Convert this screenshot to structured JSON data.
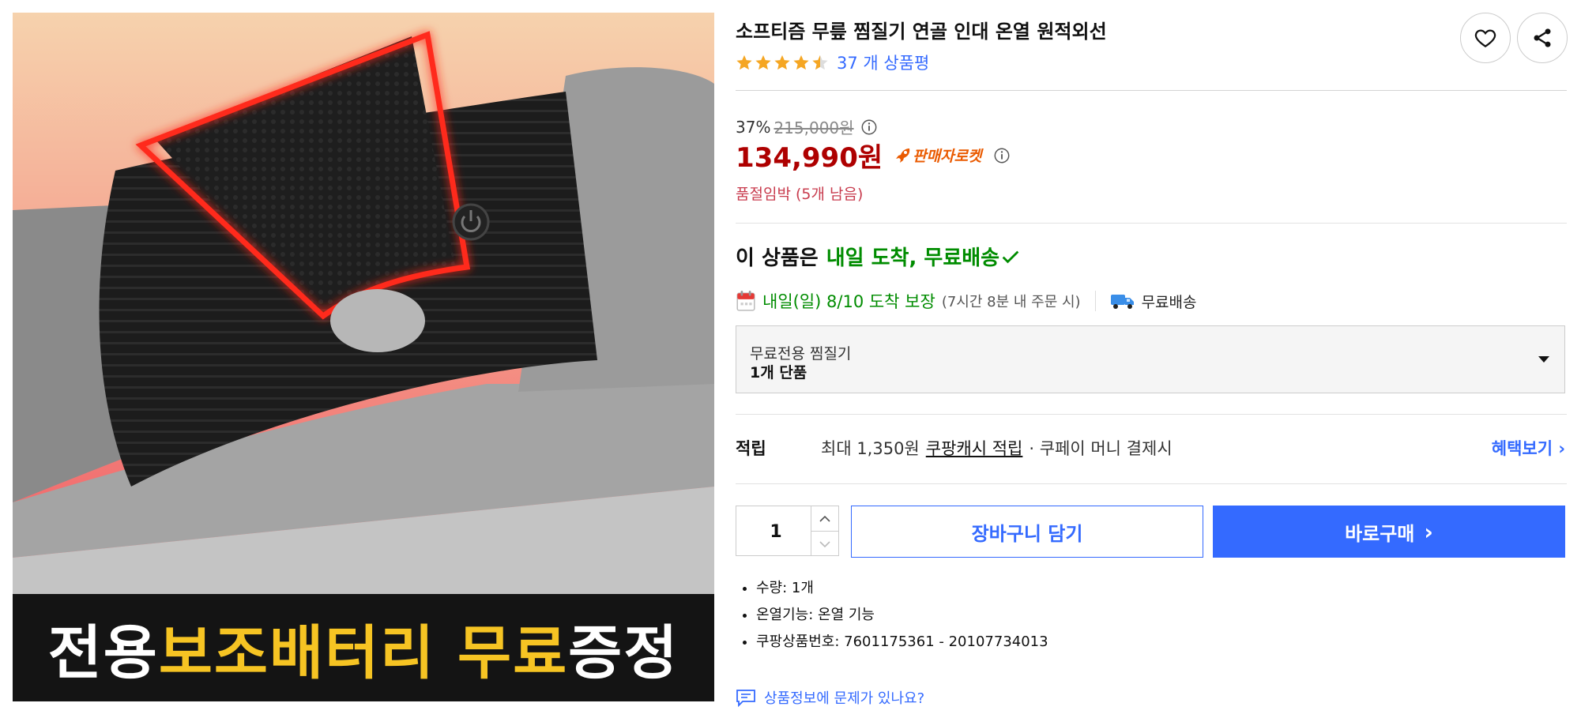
{
  "image": {
    "banner": {
      "part1": "전용 ",
      "part2": "보조배터리 무료",
      "part3": " 증정"
    }
  },
  "product": {
    "title": "소프티즘 무릎 찜질기 연골 인대 온열 원적외선",
    "rating_stars": 4.5,
    "review_count_text": "37 개 상품평"
  },
  "pricing": {
    "discount_rate": "37%",
    "original_price": "215,000원",
    "sale_price": "134,990원",
    "seller_badge": "판매자로켓",
    "stock_notice": "품절임박 (5개 남음)"
  },
  "delivery": {
    "headline_prefix": "이 상품은",
    "headline_highlight": "내일 도착, 무료배송",
    "arrival": "내일(일) 8/10 도착 보장",
    "cutoff": "(7시간 8분 내 주문 시)",
    "free_shipping": "무료배송"
  },
  "option": {
    "name": "무료전용 찜질기",
    "value": "1개 단품"
  },
  "reward": {
    "label": "적립",
    "prefix": "최대 1,350원",
    "link": "쿠팡캐시 적립",
    "suffix": "· 쿠페이 머니 결제시",
    "benefit_link": "혜택보기 ›"
  },
  "purchase": {
    "quantity": "1",
    "cart_label": "장바구니 담기",
    "buy_label": "바로구매",
    "buy_chevron": "›"
  },
  "specs": [
    "수량: 1개",
    "온열기능: 온열 기능",
    "쿠팡상품번호: 7601175361 - 20107734013"
  ],
  "report_link": "상품정보에 문제가 있나요?",
  "colors": {
    "accent_blue": "#346aff",
    "price_red": "#ae0000",
    "delivery_green": "#008c00",
    "rocket_orange": "#ea5a00",
    "stock_pink": "#c83c4e",
    "star_yellow": "#f5a623"
  },
  "icons": {
    "wishlist": "heart-icon",
    "share": "share-icon",
    "info": "info-icon",
    "rocket": "rocket-icon",
    "calendar": "calendar-icon",
    "truck": "truck-icon",
    "caret": "caret-down-icon",
    "check": "check-icon",
    "report": "chat-bubble-icon"
  }
}
